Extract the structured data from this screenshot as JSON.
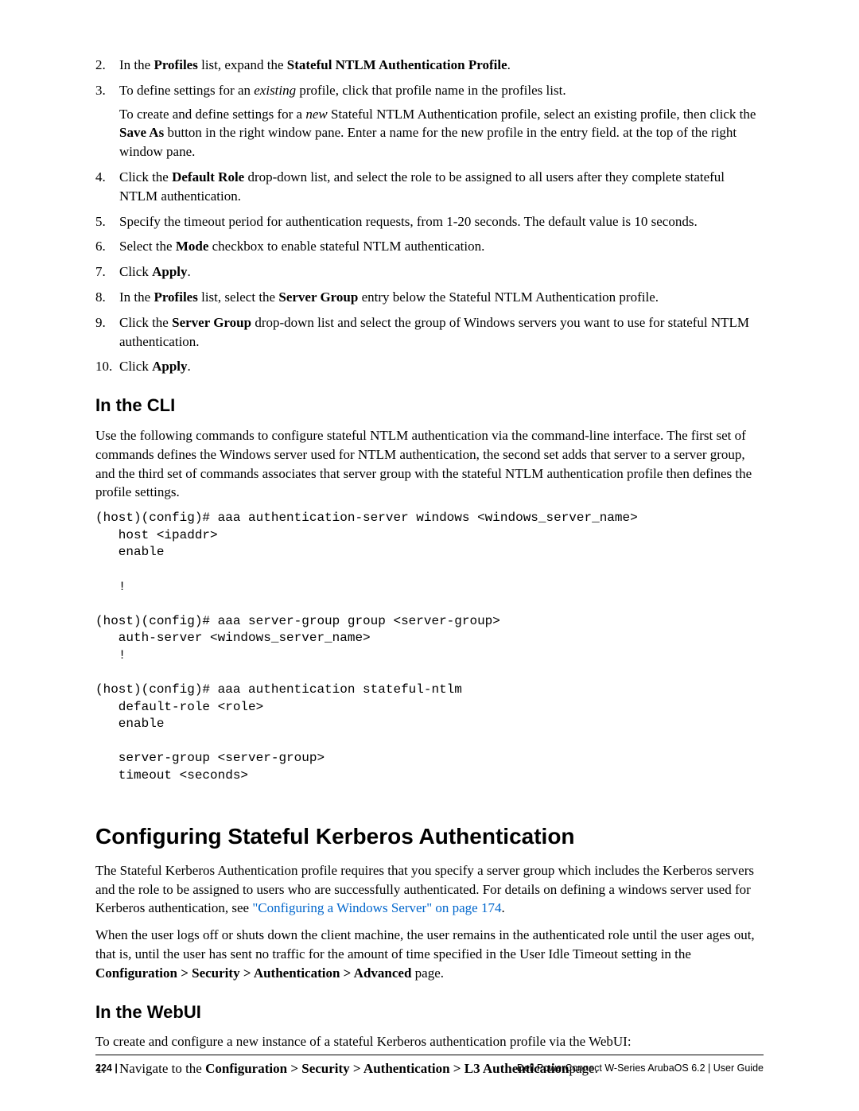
{
  "steps_a": {
    "s2": {
      "num": "2.",
      "pre": "In the ",
      "b1": "Profiles",
      "mid": " list, expand the ",
      "b2": "Stateful NTLM Authentication Profile",
      "post": "."
    },
    "s3": {
      "num": "3.",
      "line1_pre": "To define settings for an ",
      "line1_i": "existing",
      "line1_post": " profile, click that profile name in the profiles list.",
      "line2_pre": "To create and define settings for a ",
      "line2_i": "new",
      "line2_mid": " Stateful NTLM Authentication profile, select an existing profile, then click the ",
      "line2_b": "Save As",
      "line2_post": " button in the right window pane. Enter a name for the new profile in the entry field. at the top of the right window pane."
    },
    "s4": {
      "num": "4.",
      "pre": "Click the ",
      "b1": "Default Role",
      "post": " drop-down list, and select the role to be assigned to all users after they complete stateful NTLM authentication."
    },
    "s5": {
      "num": "5.",
      "text": "Specify the timeout period for authentication requests, from 1-20 seconds. The default value is 10 seconds."
    },
    "s6": {
      "num": "6.",
      "pre": "Select the ",
      "b1": "Mode",
      "post": " checkbox to enable stateful NTLM authentication."
    },
    "s7": {
      "num": "7.",
      "pre": "Click ",
      "b1": "Apply",
      "post": "."
    },
    "s8": {
      "num": "8.",
      "pre": "In the ",
      "b1": "Profiles",
      "mid": " list, select the ",
      "b2": "Server Group",
      "post": " entry below the Stateful NTLM Authentication profile."
    },
    "s9": {
      "num": "9.",
      "pre": "Click the ",
      "b1": "Server Group",
      "post": " drop-down list and select the group of Windows servers you want to use for stateful NTLM authentication."
    },
    "s10": {
      "num": "10.",
      "pre": "Click ",
      "b1": "Apply",
      "post": "."
    }
  },
  "cli_heading": "In the CLI",
  "cli_para": "Use the following commands to configure stateful NTLM authentication via the command-line interface. The first set of commands defines the Windows server used for NTLM authentication, the second set adds that server to a server group, and the third set of commands associates that server group with the stateful NTLM authentication profile then defines the profile settings.",
  "cli_code": "(host)(config)# aaa authentication-server windows <windows_server_name>\n   host <ipaddr>\n   enable\n\n   !\n\n(host)(config)# aaa server-group group <server-group>\n   auth-server <windows_server_name>\n   !\n\n(host)(config)# aaa authentication stateful-ntlm\n   default-role <role>\n   enable\n\n   server-group <server-group>\n   timeout <seconds>",
  "kerb_heading": "Configuring Stateful Kerberos Authentication",
  "kerb_para1_pre": "The Stateful Kerberos Authentication profile requires that you specify a server group which includes the Kerberos servers and the role to be assigned to users who are successfully authenticated. For details on defining a windows server used for Kerberos authentication, see ",
  "kerb_link": "\"Configuring a Windows Server\" on page 174",
  "kerb_para1_post": ".",
  "kerb_para2_pre": "When the user logs off or shuts down the client machine, the user remains in the authenticated role until the user ages out, that is, until the user has sent no traffic for the amount of time specified in the User Idle Timeout setting in the ",
  "kerb_para2_b": "Configuration > Security > Authentication > Advanced",
  "kerb_para2_post": " page.",
  "webui_heading": "In the WebUI",
  "webui_para": "To create and configure a new instance of a stateful Kerberos authentication profile via the WebUI:",
  "steps_b": {
    "s1": {
      "num": "1.",
      "pre": "Navigate to the ",
      "b1": "Configuration > Security > Authentication > L3 Authentication",
      "post": "page."
    }
  },
  "footer": {
    "page": "224 |",
    "right": "Dell PowerConnect W-Series ArubaOS 6.2  |  User Guide"
  }
}
